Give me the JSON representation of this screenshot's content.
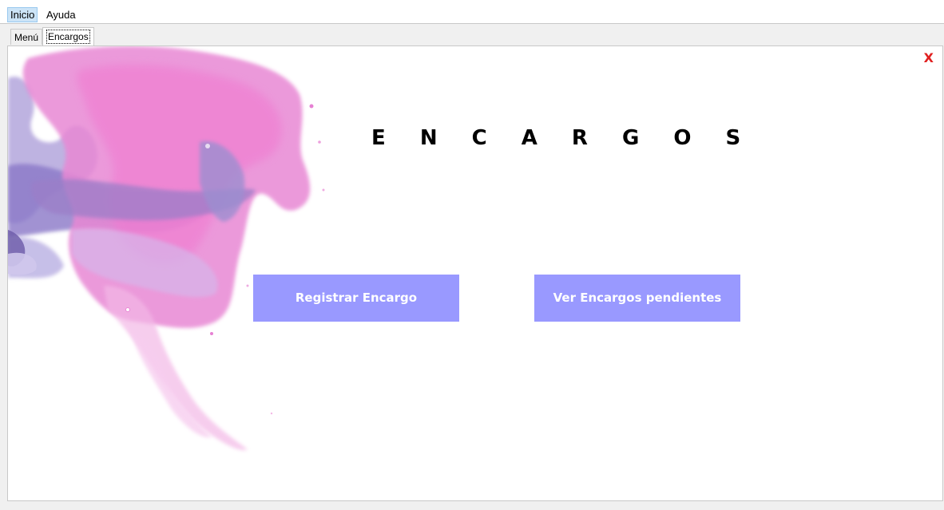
{
  "menubar": {
    "items": [
      {
        "label": "Inicio"
      },
      {
        "label": "Ayuda"
      }
    ]
  },
  "tabs": [
    {
      "label": "Menú"
    },
    {
      "label": "Encargos"
    }
  ],
  "panel": {
    "close_label": "X",
    "title": "E N C A R G O S",
    "buttons": {
      "register": "Registrar Encargo",
      "pending": "Ver Encargos pendientes"
    }
  },
  "colors": {
    "button_bg": "#9999ff",
    "close_color": "#e02020",
    "watercolor_pink": "#e87fd0",
    "watercolor_purple": "#9d8ad0"
  },
  "icons": {
    "close": "close-icon"
  }
}
